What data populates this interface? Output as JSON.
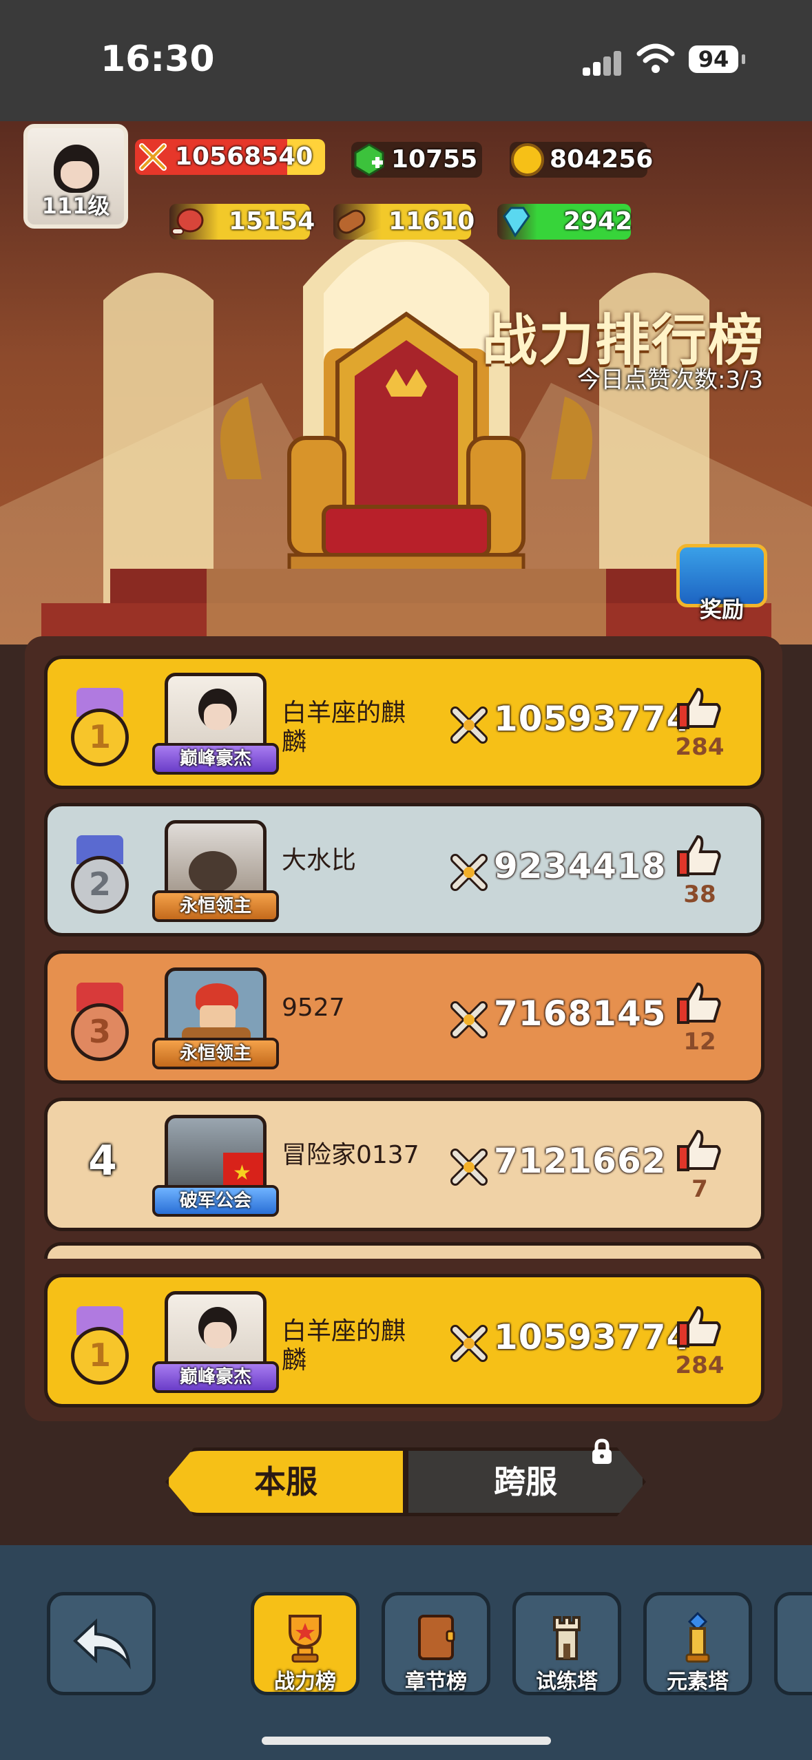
{
  "status_bar": {
    "time": "16:30",
    "battery": "94"
  },
  "resources": {
    "level": "111级",
    "combat_power": "10568540",
    "gems": "10755",
    "gold": "804256",
    "meat": "15154",
    "wood": "11610",
    "diamonds": "2942"
  },
  "header": {
    "title": "战力排行榜",
    "likes_today": "今日点赞次数:3/3",
    "reward_label": "奖励"
  },
  "ranking": [
    {
      "rank": "1",
      "name": "白羊座的麒麟",
      "badge": "巅峰豪杰",
      "power": "10593774",
      "likes": "284",
      "style": "gold"
    },
    {
      "rank": "2",
      "name": "大水比",
      "badge": "永恒领主",
      "power": "9234418",
      "likes": "38",
      "style": "silver"
    },
    {
      "rank": "3",
      "name": "9527",
      "badge": "永恒领主",
      "power": "7168145",
      "likes": "12",
      "style": "bronze"
    },
    {
      "rank": "4",
      "name": "冒险家0137",
      "badge": "破军公会",
      "power": "7121662",
      "likes": "7",
      "style": "plain"
    }
  ],
  "my_rank": {
    "rank": "1",
    "name": "白羊座的麒麟",
    "badge": "巅峰豪杰",
    "power": "10593774",
    "likes": "284"
  },
  "tabs": {
    "local": "本服",
    "cross": "跨服"
  },
  "nav": {
    "power_rank": "战力榜",
    "chapter_rank": "章节榜",
    "trial_tower": "试练塔",
    "element_tower": "元素塔"
  },
  "colors": {
    "gold_row": "#f6c017",
    "silver_row": "#c9d6d8",
    "bronze_row": "#e6904e",
    "plain_row": "#f0d2a6",
    "nav_bg": "#2f4558"
  }
}
